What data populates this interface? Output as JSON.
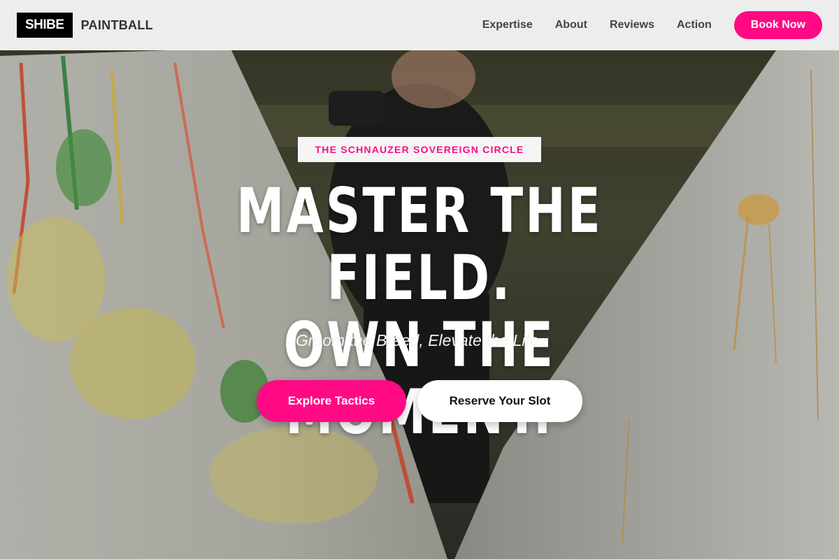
{
  "brand": {
    "logo_text": "SHIBE",
    "name": "PAINTBALL"
  },
  "nav": {
    "links": [
      "Expertise",
      "About",
      "Reviews",
      "Action"
    ],
    "cta_label": "Book Now"
  },
  "hero": {
    "eyebrow": "THE SCHNAUZER SOVEREIGN CIRCLE",
    "headline_line1": "MASTER THE FIELD.",
    "headline_line2": "OWN THE MOMENT.",
    "subline": "Groom the Breed, Elevate the Life.",
    "primary_cta": "Explore Tactics",
    "secondary_cta": "Reserve Your Slot",
    "background_image": "paintball-player-between-inflatable-bunkers"
  },
  "colors": {
    "accent": "#ff0a84",
    "header_bg": "#f4f4f4",
    "logo_bg": "#000000"
  }
}
